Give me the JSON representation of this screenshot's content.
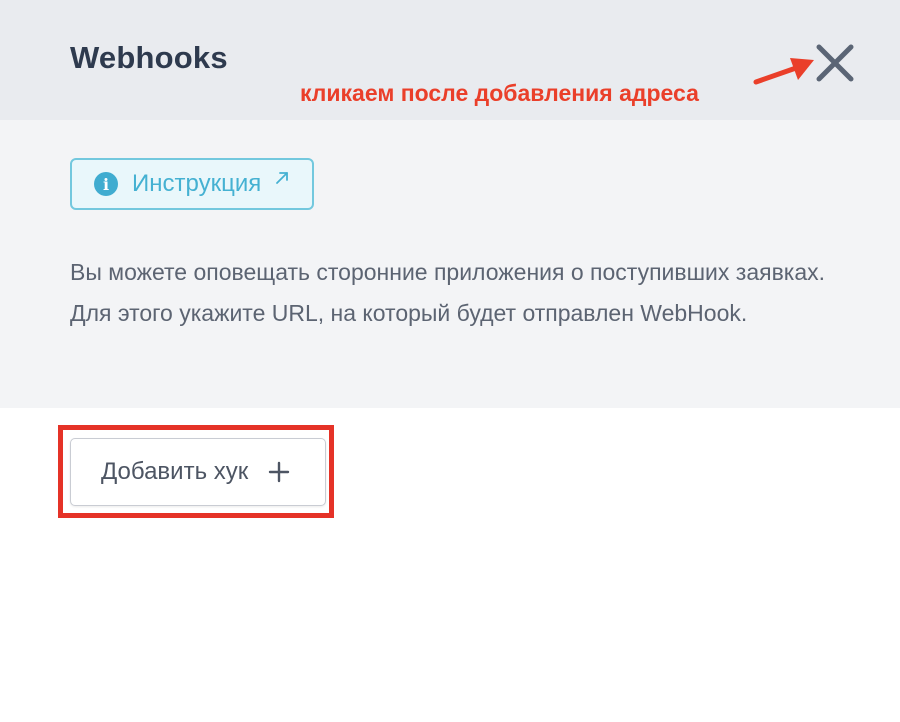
{
  "header": {
    "title": "Webhooks",
    "close_icon": "close-icon"
  },
  "annotation": {
    "text": "кликаем после добавления адреса",
    "color": "#ea3f2a"
  },
  "info": {
    "instruction_label": "Инструкция",
    "info_icon": "info-icon",
    "external_icon": "external-link-icon",
    "description": "Вы можете оповещать сторонние приложения о поступивших заявках. Для этого укажите URL, на который будет отправлен WebHook."
  },
  "actions": {
    "add_hook_label": "Добавить хук",
    "add_icon": "plus-icon"
  },
  "colors": {
    "header_bg": "#e9ebef",
    "panel_bg": "#f3f4f6",
    "accent": "#45b1d2",
    "highlight": "#e53227"
  }
}
